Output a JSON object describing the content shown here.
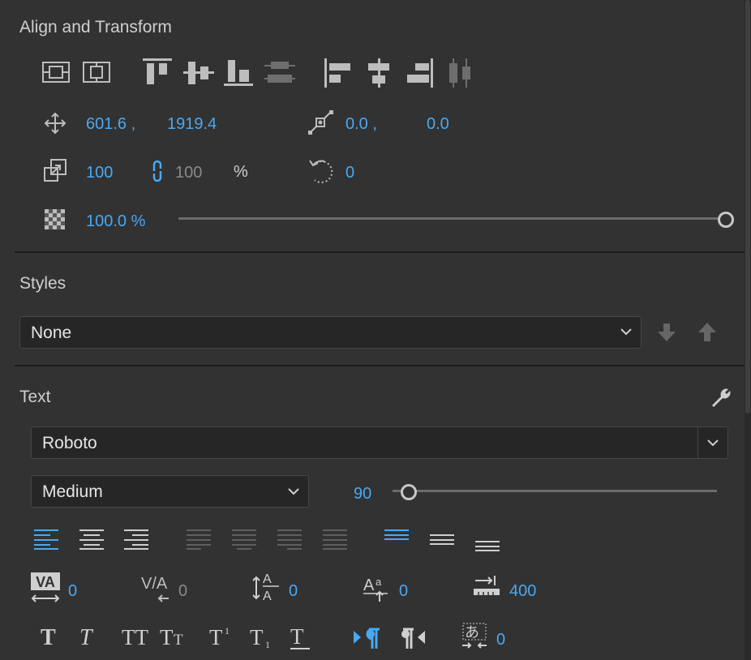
{
  "align_transform": {
    "title": "Align and Transform",
    "position": {
      "x": "601.6 ,",
      "y": "1919.4"
    },
    "anchor": {
      "x": "0.0 ,",
      "y": "0.0"
    },
    "scale": {
      "value": "100",
      "linked_value": "100",
      "unit": "%"
    },
    "rotation": "0",
    "opacity": {
      "value": "100.0 %",
      "level": 1.0
    }
  },
  "styles": {
    "title": "Styles",
    "selected": "None"
  },
  "text": {
    "title": "Text",
    "font_family": "Roboto",
    "font_style": "Medium",
    "font_size": "90",
    "font_size_level": 0.03,
    "kerning": "0",
    "tracking": "0",
    "leading": "0",
    "baseline_shift": "0",
    "tab_width": "400",
    "tsume": "0",
    "colors": {
      "accent": "#47a9f4",
      "bg": "#323232"
    }
  }
}
